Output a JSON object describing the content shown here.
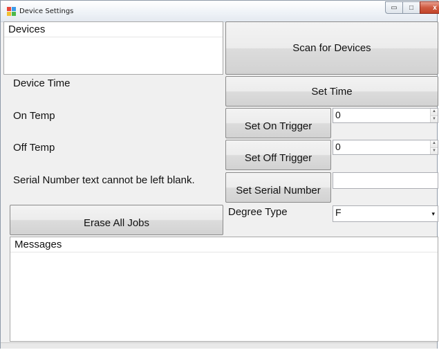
{
  "window": {
    "title": "Device Settings",
    "minimize_symbol": "▭",
    "maximize_symbol": "□",
    "close_symbol": "x"
  },
  "devices": {
    "header": "Devices",
    "items": []
  },
  "buttons": {
    "scan": "Scan for Devices",
    "set_time": "Set Time",
    "set_on_trigger": "Set On Trigger",
    "set_off_trigger": "Set Off Trigger",
    "set_serial": "Set Serial Number",
    "erase_all": "Erase All Jobs"
  },
  "labels": {
    "device_time": "Device Time",
    "on_temp": "On Temp",
    "off_temp": "Off Temp",
    "serial_warning": "Serial Number text cannot be left blank.",
    "degree_type": "Degree Type"
  },
  "inputs": {
    "on_temp_value": "0",
    "off_temp_value": "0",
    "serial_value": "",
    "degree_type_value": "F"
  },
  "messages": {
    "header": "Messages",
    "items": []
  },
  "icons": {
    "spin_up": "▲",
    "spin_down": "▼",
    "dropdown": "▾"
  }
}
